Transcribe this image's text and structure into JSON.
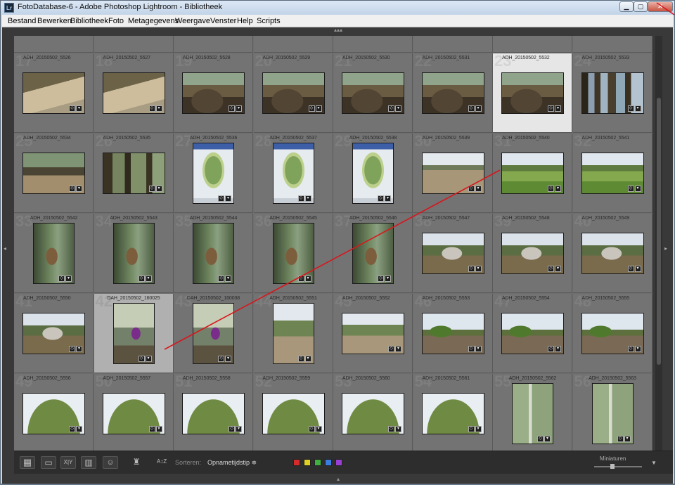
{
  "window": {
    "title": "FotoDatabase-6 - Adobe Photoshop Lightroom - Bibliotheek",
    "app_icon": "Lr",
    "controls": {
      "min": "▁",
      "max": "▢",
      "close": "✕"
    }
  },
  "menu": [
    "Bestand",
    "Bewerken",
    "Bibliotheek",
    "Foto",
    "Metagegevens",
    "Weergave",
    "Venster",
    "Help",
    "Scripts"
  ],
  "grid": {
    "rows": [
      [
        {
          "n": "",
          "name": "",
          "kind": "sand-cliff"
        },
        {
          "n": "",
          "name": "",
          "kind": "sand-cliff"
        },
        {
          "n": "",
          "name": "",
          "kind": "sand-plain"
        },
        {
          "n": "",
          "name": "",
          "kind": "sky-sand"
        },
        {
          "n": "",
          "name": "",
          "kind": "sky-sand"
        },
        {
          "n": "",
          "name": "",
          "kind": "sky-sand"
        },
        {
          "n": "",
          "name": "",
          "kind": "sky-sand"
        },
        {
          "n": "",
          "name": "",
          "kind": "sky-sand"
        }
      ],
      [
        {
          "n": "17",
          "name": "ADH_20150502_5526",
          "kind": "sand-cliff"
        },
        {
          "n": "18",
          "name": "ADH_20150502_5527",
          "kind": "sand-cliff"
        },
        {
          "n": "19",
          "name": "ADH_20150502_5528",
          "kind": "roots"
        },
        {
          "n": "20",
          "name": "ADH_20150502_5529",
          "kind": "roots"
        },
        {
          "n": "21",
          "name": "ADH_20150502_5530",
          "kind": "roots"
        },
        {
          "n": "22",
          "name": "ADH_20150502_5531",
          "kind": "roots"
        },
        {
          "n": "23",
          "name": "ADH_20150502_5532",
          "kind": "roots",
          "state": "selected"
        },
        {
          "n": "24",
          "name": "ADH_20150502_5533",
          "kind": "forest-person"
        }
      ],
      [
        {
          "n": "25",
          "name": "ADH_20150502_5534",
          "kind": "forest-path"
        },
        {
          "n": "26",
          "name": "ADH_20150502_5535",
          "kind": "forest-dark"
        },
        {
          "n": "27",
          "name": "ADH_20150502_5536",
          "kind": "map",
          "orient": "port"
        },
        {
          "n": "28",
          "name": "ADH_20150502_5537",
          "kind": "map",
          "orient": "port"
        },
        {
          "n": "29",
          "name": "ADH_20150502_5538",
          "kind": "map",
          "orient": "port"
        },
        {
          "n": "30",
          "name": "ADH_20150502_5539",
          "kind": "field-sky"
        },
        {
          "n": "31",
          "name": "ADH_20150502_5540",
          "kind": "green-field"
        },
        {
          "n": "32",
          "name": "ADH_20150502_5541",
          "kind": "green-field"
        }
      ],
      [
        {
          "n": "33",
          "name": "ADH_20150502_5542",
          "kind": "fern",
          "orient": "port"
        },
        {
          "n": "34",
          "name": "ADH_20150502_5543",
          "kind": "fern",
          "orient": "port"
        },
        {
          "n": "35",
          "name": "ADH_20150502_5544",
          "kind": "fern",
          "orient": "port"
        },
        {
          "n": "36",
          "name": "ADH_20150502_5545",
          "kind": "fern",
          "orient": "port"
        },
        {
          "n": "37",
          "name": "ADH_20150502_5546",
          "kind": "fern",
          "orient": "port"
        },
        {
          "n": "38",
          "name": "ADH_20150502_5547",
          "kind": "boulder"
        },
        {
          "n": "39",
          "name": "ADH_20150502_5548",
          "kind": "boulder"
        },
        {
          "n": "40",
          "name": "ADH_20150502_5549",
          "kind": "boulder"
        }
      ],
      [
        {
          "n": "41",
          "name": "ADH_20150502_5550",
          "kind": "boulder"
        },
        {
          "n": "42",
          "name": "DAH_20150502_160025",
          "kind": "hikers",
          "orient": "port",
          "state": "active"
        },
        {
          "n": "43",
          "name": "DAH_20150502_160038",
          "kind": "hikers",
          "orient": "port"
        },
        {
          "n": "44",
          "name": "ADH_20150502_5551",
          "kind": "trees-path",
          "orient": "port"
        },
        {
          "n": "45",
          "name": "ADH_20150502_5552",
          "kind": "trees-path"
        },
        {
          "n": "46",
          "name": "ADH_20150502_5553",
          "kind": "heath"
        },
        {
          "n": "47",
          "name": "ADH_20150502_5554",
          "kind": "heath"
        },
        {
          "n": "48",
          "name": "ADH_20150502_5555",
          "kind": "heath"
        }
      ],
      [
        {
          "n": "49",
          "name": "ADH_20150502_5556",
          "kind": "canopy"
        },
        {
          "n": "50",
          "name": "ADH_20150502_5557",
          "kind": "canopy"
        },
        {
          "n": "51",
          "name": "ADH_20150502_5558",
          "kind": "canopy"
        },
        {
          "n": "52",
          "name": "ADH_20150502_5559",
          "kind": "canopy"
        },
        {
          "n": "53",
          "name": "ADH_20150502_5560",
          "kind": "canopy"
        },
        {
          "n": "54",
          "name": "ADH_20150502_5561",
          "kind": "canopy"
        },
        {
          "n": "55",
          "name": "ADH_20150502_5562",
          "kind": "birch",
          "orient": "port"
        },
        {
          "n": "56",
          "name": "ADH_20150502_5563",
          "kind": "birch",
          "orient": "port"
        }
      ]
    ]
  },
  "toolbar": {
    "grid_view": "▦",
    "loupe_view": "▭",
    "compare_view": "X|Y",
    "survey_view": "▥",
    "people_view": "☺",
    "painter": "♜",
    "sort_direction": "A↕Z",
    "sort_label": "Sorteren:",
    "sort_value": "Opnametijdstip ≑",
    "color_labels": [
      "#d42b2b",
      "#e0d020",
      "#3fb03f",
      "#3a7de0",
      "#9a3fd6"
    ],
    "thumbnail_label": "Miniaturen",
    "menu_caret": "▼"
  },
  "badge_icons": [
    "◇",
    "▾"
  ],
  "annotation_color": "#d8161c"
}
